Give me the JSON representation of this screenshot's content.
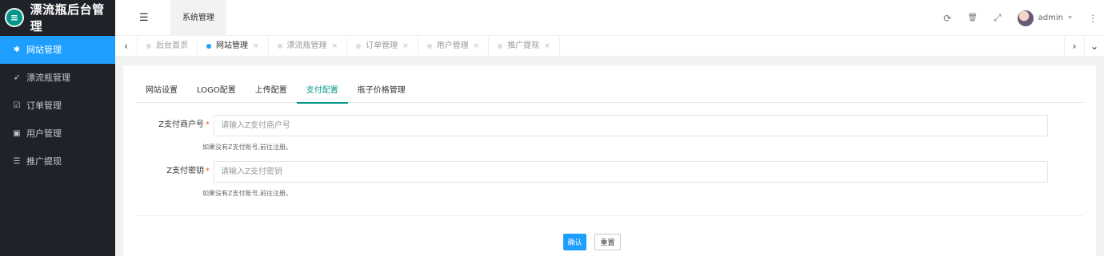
{
  "app": {
    "title": "漂流瓶后台管理",
    "logo_icon": "e-logo"
  },
  "sidebar": {
    "items": [
      {
        "label": "网站管理",
        "icon": "gear-icon",
        "glyph": "✱",
        "active": true
      },
      {
        "label": "漂流瓶管理",
        "icon": "rocket-icon",
        "glyph": "➶",
        "active": false
      },
      {
        "label": "订单管理",
        "icon": "calendar-icon",
        "glyph": "☑",
        "active": false
      },
      {
        "label": "用户管理",
        "icon": "user-card-icon",
        "glyph": "▣",
        "active": false
      },
      {
        "label": "推广提现",
        "icon": "list-icon",
        "glyph": "☰",
        "active": false
      }
    ]
  },
  "header": {
    "menu_toggle_glyph": "☰",
    "tab_label": "系统管理",
    "username": "admin",
    "icons": {
      "refresh": "⟳",
      "trash": "🗑",
      "fullscreen": "⤢",
      "more": "⋮",
      "caret": "▾"
    }
  },
  "tabs": {
    "items": [
      {
        "label": "后台首页",
        "active": false,
        "closable": false
      },
      {
        "label": "网站管理",
        "active": true,
        "closable": true
      },
      {
        "label": "漂流瓶管理",
        "active": false,
        "closable": true
      },
      {
        "label": "订单管理",
        "active": false,
        "closable": true
      },
      {
        "label": "用户管理",
        "active": false,
        "closable": true
      },
      {
        "label": "推广提现",
        "active": false,
        "closable": true
      }
    ],
    "left_arrow": "‹",
    "right_arrow": "›",
    "down_arrow": "⌄",
    "close_glyph": "×"
  },
  "card": {
    "tabs": [
      {
        "label": "网站设置",
        "active": false
      },
      {
        "label": "LOGO配置",
        "active": false
      },
      {
        "label": "上传配置",
        "active": false
      },
      {
        "label": "支付配置",
        "active": true
      },
      {
        "label": "瓶子价格管理",
        "active": false
      }
    ],
    "fields": [
      {
        "label": "Z支付商户号",
        "required_mark": "*",
        "value": "",
        "placeholder": "请输入Z支付商户号",
        "hint": "如果没有Z支付账号,前往注册。"
      },
      {
        "label": "Z支付密钥",
        "required_mark": "*",
        "value": "",
        "placeholder": "请输入Z支付密钥",
        "hint": "如果没有Z支付账号,前往注册。"
      }
    ],
    "confirm_label": "确认",
    "reset_label": "重置"
  },
  "colors": {
    "accent": "#1e9fff",
    "tab_active": "#009688",
    "sidebar_bg": "#20222a",
    "required": "#ff5722"
  }
}
